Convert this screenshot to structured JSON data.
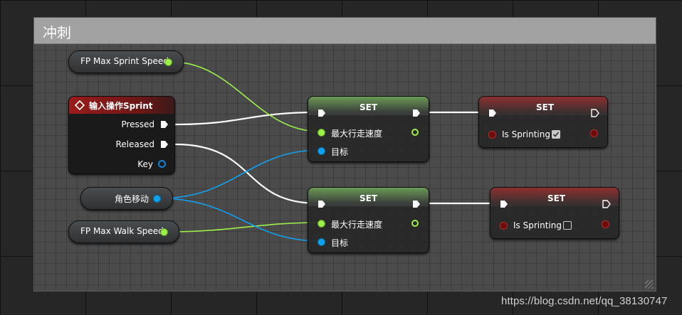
{
  "comment": {
    "title": "冲刺"
  },
  "nodes": {
    "fp_max_sprint_speed": {
      "label": "FP Max Sprint Speed"
    },
    "input_action": {
      "title": "输入操作Sprint",
      "pressed": "Pressed",
      "released": "Released",
      "key": "Key"
    },
    "character_movement": {
      "label": "角色移动"
    },
    "fp_max_walk_speed": {
      "label": "FP Max Walk Speed"
    },
    "set_speed_1": {
      "title": "SET",
      "value_pin": "最大行走速度",
      "target_pin": "目标"
    },
    "set_speed_2": {
      "title": "SET",
      "value_pin": "最大行走速度",
      "target_pin": "目标"
    },
    "set_sprint_1": {
      "title": "SET",
      "pin": "Is Sprinting",
      "checked": true
    },
    "set_sprint_2": {
      "title": "SET",
      "pin": "Is Sprinting",
      "checked": false
    }
  },
  "colors": {
    "float_pin": "#9df04a",
    "object_pin": "#0fa2ef",
    "bool_pin": "#bb2a2a",
    "exec_wire": "#ffffff"
  },
  "watermark": "https://blog.csdn.net/qq_38130747"
}
